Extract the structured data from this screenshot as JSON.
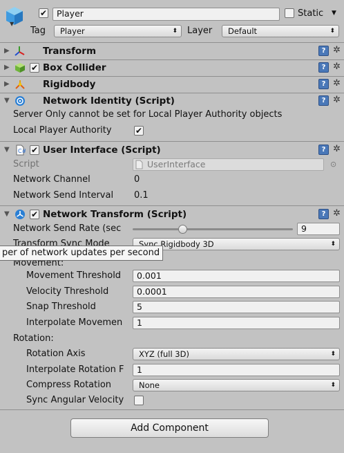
{
  "header": {
    "object_name": "Player",
    "static_label": "Static",
    "tag_label": "Tag",
    "tag_value": "Player",
    "layer_label": "Layer",
    "layer_value": "Default"
  },
  "components": {
    "transform": {
      "title": "Transform"
    },
    "box_collider": {
      "title": "Box Collider"
    },
    "rigidbody": {
      "title": "Rigidbody"
    },
    "network_identity": {
      "title": "Network Identity (Script)",
      "message": "Server Only cannot be set for Local Player Authority objects",
      "local_player_authority_label": "Local Player Authority"
    },
    "user_interface": {
      "title": "User Interface (Script)",
      "script_label": "Script",
      "script_value": "UserInterface",
      "network_channel_label": "Network Channel",
      "network_channel_value": "0",
      "network_send_interval_label": "Network Send Interval",
      "network_send_interval_value": "0.1"
    },
    "network_transform": {
      "title": "Network Transform (Script)",
      "send_rate_label": "Network Send Rate (sec",
      "send_rate_value": "9",
      "send_rate_fraction": 0.3,
      "sync_mode_label": "Transform Sync Mode",
      "sync_mode_value": "Sync Rigidbody 3D",
      "tooltip": "per of network updates per second",
      "movement_label": "Movement:",
      "movement_threshold_label": "Movement Threshold",
      "movement_threshold_value": "0.001",
      "velocity_threshold_label": "Velocity Threshold",
      "velocity_threshold_value": "0.0001",
      "snap_threshold_label": "Snap Threshold",
      "snap_threshold_value": "5",
      "interpolate_movement_label": "Interpolate Movemen",
      "interpolate_movement_value": "1",
      "rotation_label": "Rotation:",
      "rotation_axis_label": "Rotation Axis",
      "rotation_axis_value": "XYZ (full 3D)",
      "interpolate_rotation_label": "Interpolate Rotation F",
      "interpolate_rotation_value": "1",
      "compress_rotation_label": "Compress Rotation",
      "compress_rotation_value": "None",
      "sync_angular_velocity_label": "Sync Angular Velocity"
    }
  },
  "add_component_label": "Add Component",
  "colors": {
    "panel": "#c2c2c2",
    "help_blue": "#4a78b8",
    "field": "#f0f0f0"
  }
}
